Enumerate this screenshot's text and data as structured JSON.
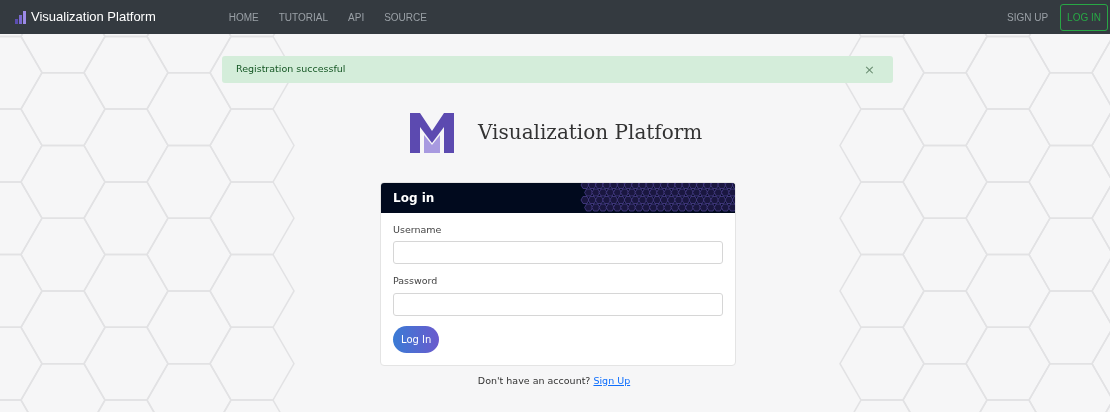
{
  "navbar": {
    "brand": "Visualization Platform",
    "links": [
      "HOME",
      "TUTORIAL",
      "API",
      "SOURCE"
    ],
    "signup": "SIGN UP",
    "login": "LOG IN"
  },
  "alert": {
    "message": "Registration successful",
    "close": "×"
  },
  "heading": {
    "title": "Visualization Platform"
  },
  "login_card": {
    "title": "Log in",
    "fields": [
      {
        "label": "Username"
      },
      {
        "label": "Password"
      }
    ],
    "button": "Log In"
  },
  "footer": {
    "text": "Don't have an account?",
    "link": "Sign Up"
  }
}
